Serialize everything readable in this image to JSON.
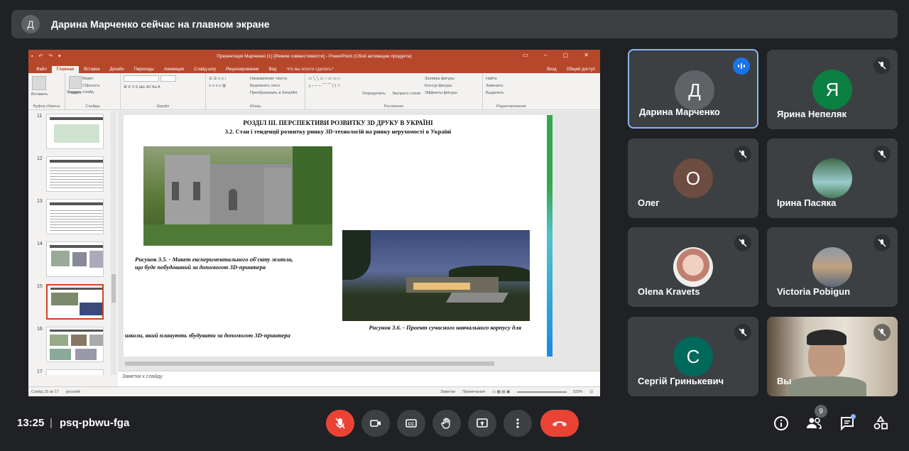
{
  "banner": {
    "avatar_letter": "Д",
    "text": "Дарина Марченко сейчас на главном экране"
  },
  "powerpoint": {
    "window_title": "Презентація Марченко (1) [Режим совместимости] - PowerPoint (Сбой активации продукта)",
    "tabs": [
      "Файл",
      "Главная",
      "Вставка",
      "Дизайн",
      "Переходы",
      "Анимация",
      "Слайд-шоу",
      "Рецензирование",
      "Вид"
    ],
    "active_tab": "Главная",
    "tell_me": "Что вы хотите сделать?",
    "sign_in": "Вход",
    "share": "Общий доступ",
    "ribbon": {
      "paste": "Вставить",
      "clipboard_group": "Буфер обмена",
      "new_slide": "Создать слайд",
      "layout": "Макет",
      "reset": "Сбросить",
      "section": "Раздел",
      "slides_group": "Слайды",
      "font_group": "Шрифт",
      "paragraph_group": "Абзац",
      "text_direction": "Направление текста",
      "align_text": "Выровнять текст",
      "smartart": "Преобразовать в SmartArt",
      "arrange": "Упорядочить",
      "quick_styles": "Экспресс-стили",
      "shape_fill": "Заливка фигуры",
      "shape_outline": "Контур фигуры",
      "shape_effects": "Эффекты фигуры",
      "drawing_group": "Рисование",
      "find": "Найти",
      "replace": "Заменить",
      "select": "Выделить",
      "editing_group": "Редактирование"
    },
    "thumbnails": [
      "11",
      "12",
      "13",
      "14",
      "15",
      "16",
      "17"
    ],
    "selected_slide": "15",
    "slide": {
      "title": "РОЗДІЛ III. ПЕРСПЕКТИВИ РОЗВИТКУ 3D ДРУКУ В УКРАЇНІ",
      "subtitle": "3.2. Стан і тенденції розвитку ринку 3D-технологій на ринку нерухомості в Україні",
      "caption1_line1": "Рисунок 3.5. - Макет експериментального об'єкту житла,",
      "caption1_line2": "що буде побудований за допомогою  3D-принтера",
      "caption2_line1": "Рисунок 3.6. -  Проект сучасного навчального корпусу для",
      "caption2_line2": "школи, який планують збудувати за допомогою  3D-принтера"
    },
    "notes_placeholder": "Заметки к слайду",
    "status": {
      "slide_counter": "Слайд 15 из 17",
      "language": "русский",
      "notes": "Заметки",
      "comments": "Примечания",
      "zoom": "103%"
    }
  },
  "participants": [
    {
      "name": "Дарина Марченко",
      "letter": "Д",
      "color": "#5f6368",
      "speaking": true
    },
    {
      "name": "Ярина Непеляк",
      "letter": "Я",
      "color": "#0b8043",
      "speaking": false
    },
    {
      "name": "Олег",
      "letter": "О",
      "color": "#6d4c41",
      "speaking": false
    },
    {
      "name": "Ірина Пасяка",
      "letter": "",
      "color": "#4a7a5a",
      "speaking": false
    },
    {
      "name": "Olena Kravets",
      "letter": "",
      "color": "#d8b8a8",
      "speaking": false
    },
    {
      "name": "Victoria Pobigun",
      "letter": "",
      "color": "#6b7a8a",
      "speaking": false
    },
    {
      "name": "Сергій Гринькевич",
      "letter": "С",
      "color": "#00695c",
      "speaking": false
    },
    {
      "name": "Вы",
      "letter": "",
      "color": "#8a7a6a",
      "speaking": false
    }
  ],
  "bottom_bar": {
    "time": "13:25",
    "separator": "|",
    "meeting_code": "psq-pbwu-fga",
    "participant_count": "9"
  }
}
